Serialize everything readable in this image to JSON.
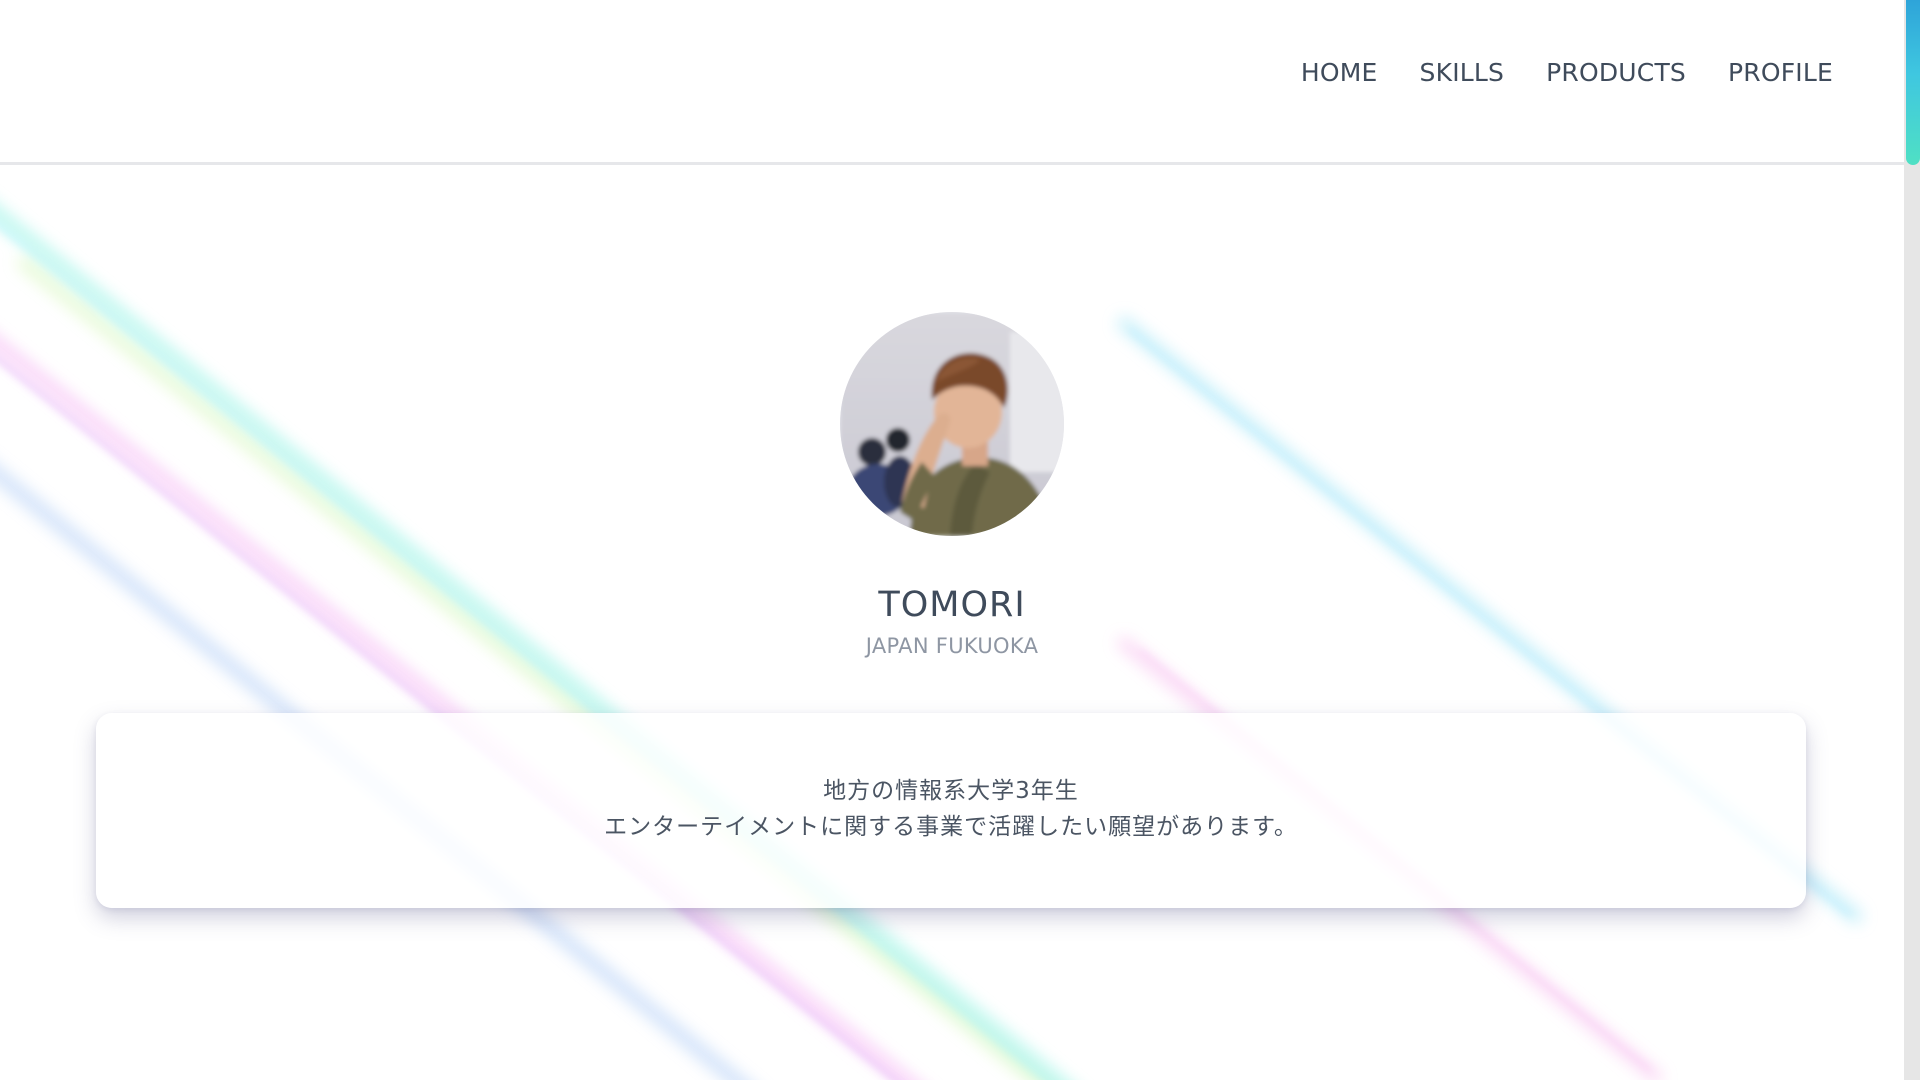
{
  "nav": {
    "items": [
      {
        "label": "HOME"
      },
      {
        "label": "SKILLS"
      },
      {
        "label": "PRODUCTS"
      },
      {
        "label": "PROFILE"
      }
    ]
  },
  "profile": {
    "name": "TOMORI",
    "location": "JAPAN FUKUOKA",
    "bio_line1": "地方の情報系大学3年生",
    "bio_line2": "エンターテイメントに関する事業で活躍したい願望があります。"
  },
  "colors": {
    "text_dark": "#3f4b5b",
    "text_muted": "#8e96a3",
    "scroll_thumb_top": "#2ea4d9",
    "scroll_thumb_bottom": "#4fe0c4"
  }
}
